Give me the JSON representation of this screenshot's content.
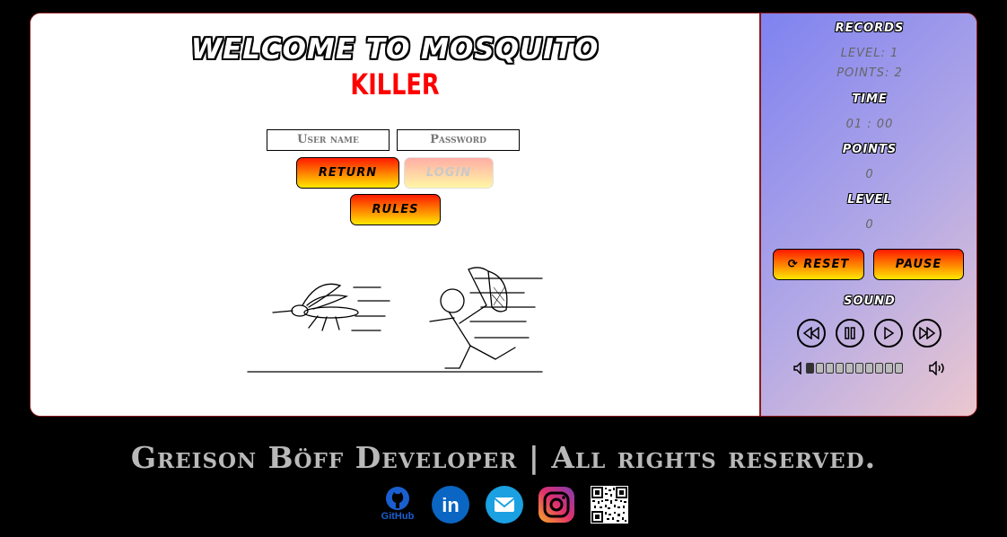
{
  "game": {
    "title_line1": "WELCOME TO MOSQUITO",
    "title_line2": "KILLER"
  },
  "login": {
    "username_placeholder": "User name",
    "password_placeholder": "Password",
    "return_label": "RETURN",
    "login_label": "LOGIN",
    "rules_label": "RULES"
  },
  "sidebar": {
    "records_label": "RECORDS",
    "records_level": "LEVEL: 1",
    "records_points": "POINTS: 2",
    "time_label": "TIME",
    "time_value": "01 : 00",
    "points_label": "POINTS",
    "points_value": "0",
    "level_label": "LEVEL",
    "level_value": "0",
    "reset_label": "RESET",
    "pause_label": "PAUSE",
    "sound_label": "SOUND",
    "volume_level": 0.1,
    "volume_segments": 10
  },
  "footer": {
    "credit": "Greison Böff Developer | All rights reserved.",
    "github_label": "GitHub"
  },
  "colors": {
    "background": "#000000",
    "accent_red": "#ff0000",
    "border": "#8b1a1a",
    "sidebar_gradient_start": "#7f82f0",
    "sidebar_gradient_end": "#ecc8cf"
  },
  "icons": [
    "reset-icon",
    "rewind-icon",
    "pause-icon",
    "play-icon",
    "fast-forward-icon",
    "volume-low-icon",
    "volume-high-icon",
    "github-icon",
    "linkedin-icon",
    "email-icon",
    "instagram-icon",
    "qr-code-icon"
  ]
}
